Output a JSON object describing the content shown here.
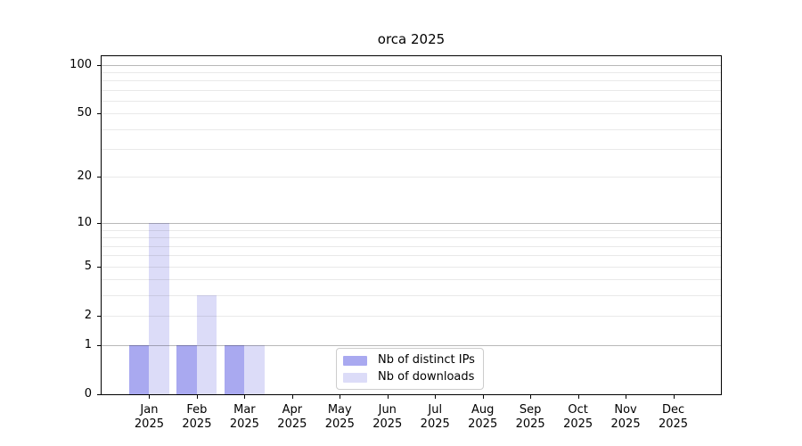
{
  "chart_data": {
    "type": "bar",
    "title": "orca 2025",
    "categories": [
      {
        "month": "Jan",
        "year": "2025"
      },
      {
        "month": "Feb",
        "year": "2025"
      },
      {
        "month": "Mar",
        "year": "2025"
      },
      {
        "month": "Apr",
        "year": "2025"
      },
      {
        "month": "May",
        "year": "2025"
      },
      {
        "month": "Jun",
        "year": "2025"
      },
      {
        "month": "Jul",
        "year": "2025"
      },
      {
        "month": "Aug",
        "year": "2025"
      },
      {
        "month": "Sep",
        "year": "2025"
      },
      {
        "month": "Oct",
        "year": "2025"
      },
      {
        "month": "Nov",
        "year": "2025"
      },
      {
        "month": "Dec",
        "year": "2025"
      }
    ],
    "series": [
      {
        "name": "Nb of distinct IPs",
        "color": "#a9a9f0",
        "values": [
          1,
          1,
          1,
          0,
          0,
          0,
          0,
          0,
          0,
          0,
          0,
          0
        ]
      },
      {
        "name": "Nb of downloads",
        "color": "#dcdcf8",
        "values": [
          10,
          3,
          1,
          0,
          0,
          0,
          0,
          0,
          0,
          0,
          0,
          0
        ]
      }
    ],
    "y_axis": {
      "scale": "log1p",
      "ticks": [
        0,
        1,
        2,
        5,
        10,
        20,
        50,
        100
      ],
      "minor_gridlines": [
        3,
        4,
        6,
        7,
        8,
        9,
        30,
        40,
        60,
        70,
        80,
        90
      ],
      "emphasized_gridlines": [
        1,
        10,
        100
      ],
      "range_max": 112
    },
    "legend": {
      "position": "lower center"
    },
    "grid": true,
    "colors": {
      "background": "#ffffff",
      "spine": "#000000",
      "text": "#000000",
      "grid_major": "rgba(0,0,0,0.28)",
      "grid_minor": "rgba(0,0,0,0.085)"
    }
  }
}
